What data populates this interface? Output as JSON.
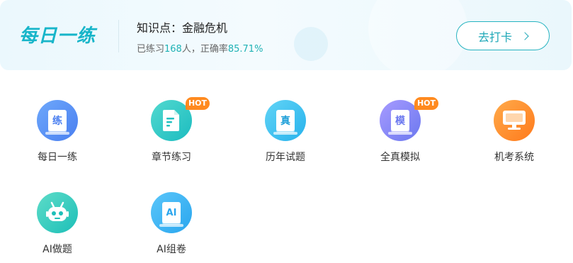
{
  "banner": {
    "title": "每日一练",
    "knowledge_point": "知识点：金融危机",
    "stats_prefix": "已练习",
    "count": "168",
    "stats_mid": "人，正确率",
    "accuracy": "85.71%",
    "checkin_label": "去打卡"
  },
  "hot_badge": "HOT",
  "items": [
    {
      "label": "每日一练",
      "glyph": "练",
      "icon": "practice-book-icon",
      "color_from": "#6ea8fb",
      "color_to": "#4a7ff0",
      "hot": false
    },
    {
      "label": "章节练习",
      "glyph": "",
      "icon": "chapter-doc-icon",
      "color_from": "#52d9cf",
      "color_to": "#1cbcc0",
      "hot": true
    },
    {
      "label": "历年试题",
      "glyph": "真",
      "icon": "past-exam-icon",
      "color_from": "#62d4f6",
      "color_to": "#27b2ec",
      "hot": false
    },
    {
      "label": "全真模拟",
      "glyph": "模",
      "icon": "mock-exam-icon",
      "color_from": "#a79bff",
      "color_to": "#6b78ef",
      "hot": true
    },
    {
      "label": "机考系统",
      "glyph": "",
      "icon": "computer-exam-icon",
      "color_from": "#ffaa4a",
      "color_to": "#ff7a1c",
      "hot": false
    },
    {
      "label": "AI做题",
      "glyph": "",
      "icon": "ai-robot-icon",
      "color_from": "#5ddcc8",
      "color_to": "#1dbfb8",
      "hot": false
    },
    {
      "label": "AI组卷",
      "glyph": "AI",
      "icon": "ai-paper-icon",
      "color_from": "#5ac6fa",
      "color_to": "#2aa6ee",
      "hot": false
    }
  ]
}
